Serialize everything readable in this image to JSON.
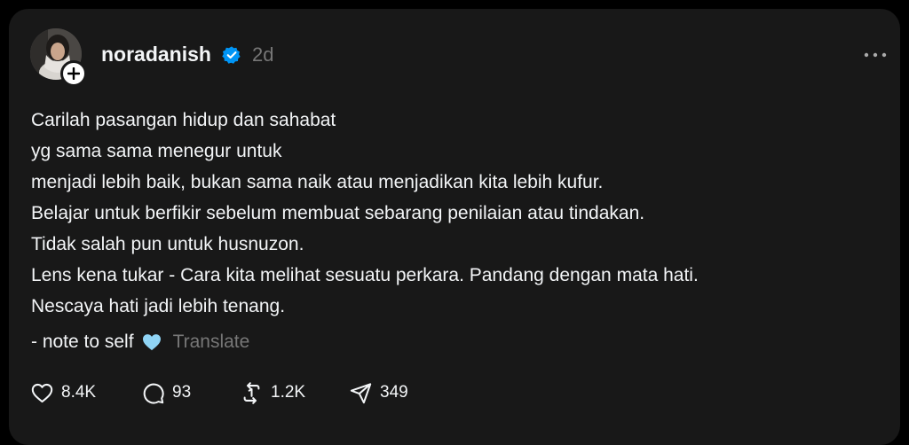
{
  "post": {
    "username": "noradanish",
    "time": "2d",
    "lines": [
      "Carilah pasangan hidup dan sahabat",
      "yg sama sama menegur untuk",
      "menjadi lebih baik, bukan sama naik atau menjadikan kita lebih kufur.",
      "Belajar untuk berfikir sebelum membuat sebarang penilaian atau tindakan.",
      "Tidak salah pun untuk husnuzon.",
      "Lens kena tukar - Cara kita melihat sesuatu perkara. Pandang dengan mata hati.",
      "Nescaya hati jadi lebih tenang."
    ],
    "note": "- note to self",
    "translate_label": "Translate"
  },
  "actions": {
    "likes": "8.4K",
    "replies": "93",
    "reposts": "1.2K",
    "shares": "349"
  },
  "icons": {
    "avatar": "profile-photo",
    "follow": "plus-icon",
    "verified": "verified-badge-icon",
    "more": "more-options-icon",
    "emoji": "light-blue-heart-icon",
    "like": "heart-icon",
    "reply": "comment-icon",
    "repost": "repost-icon",
    "share": "send-icon"
  },
  "colors": {
    "background": "#000000",
    "card": "#181818",
    "text": "#f3f5f7",
    "muted": "#777777",
    "verified": "#0095f6",
    "heart_emoji": "#8fd4f5"
  }
}
